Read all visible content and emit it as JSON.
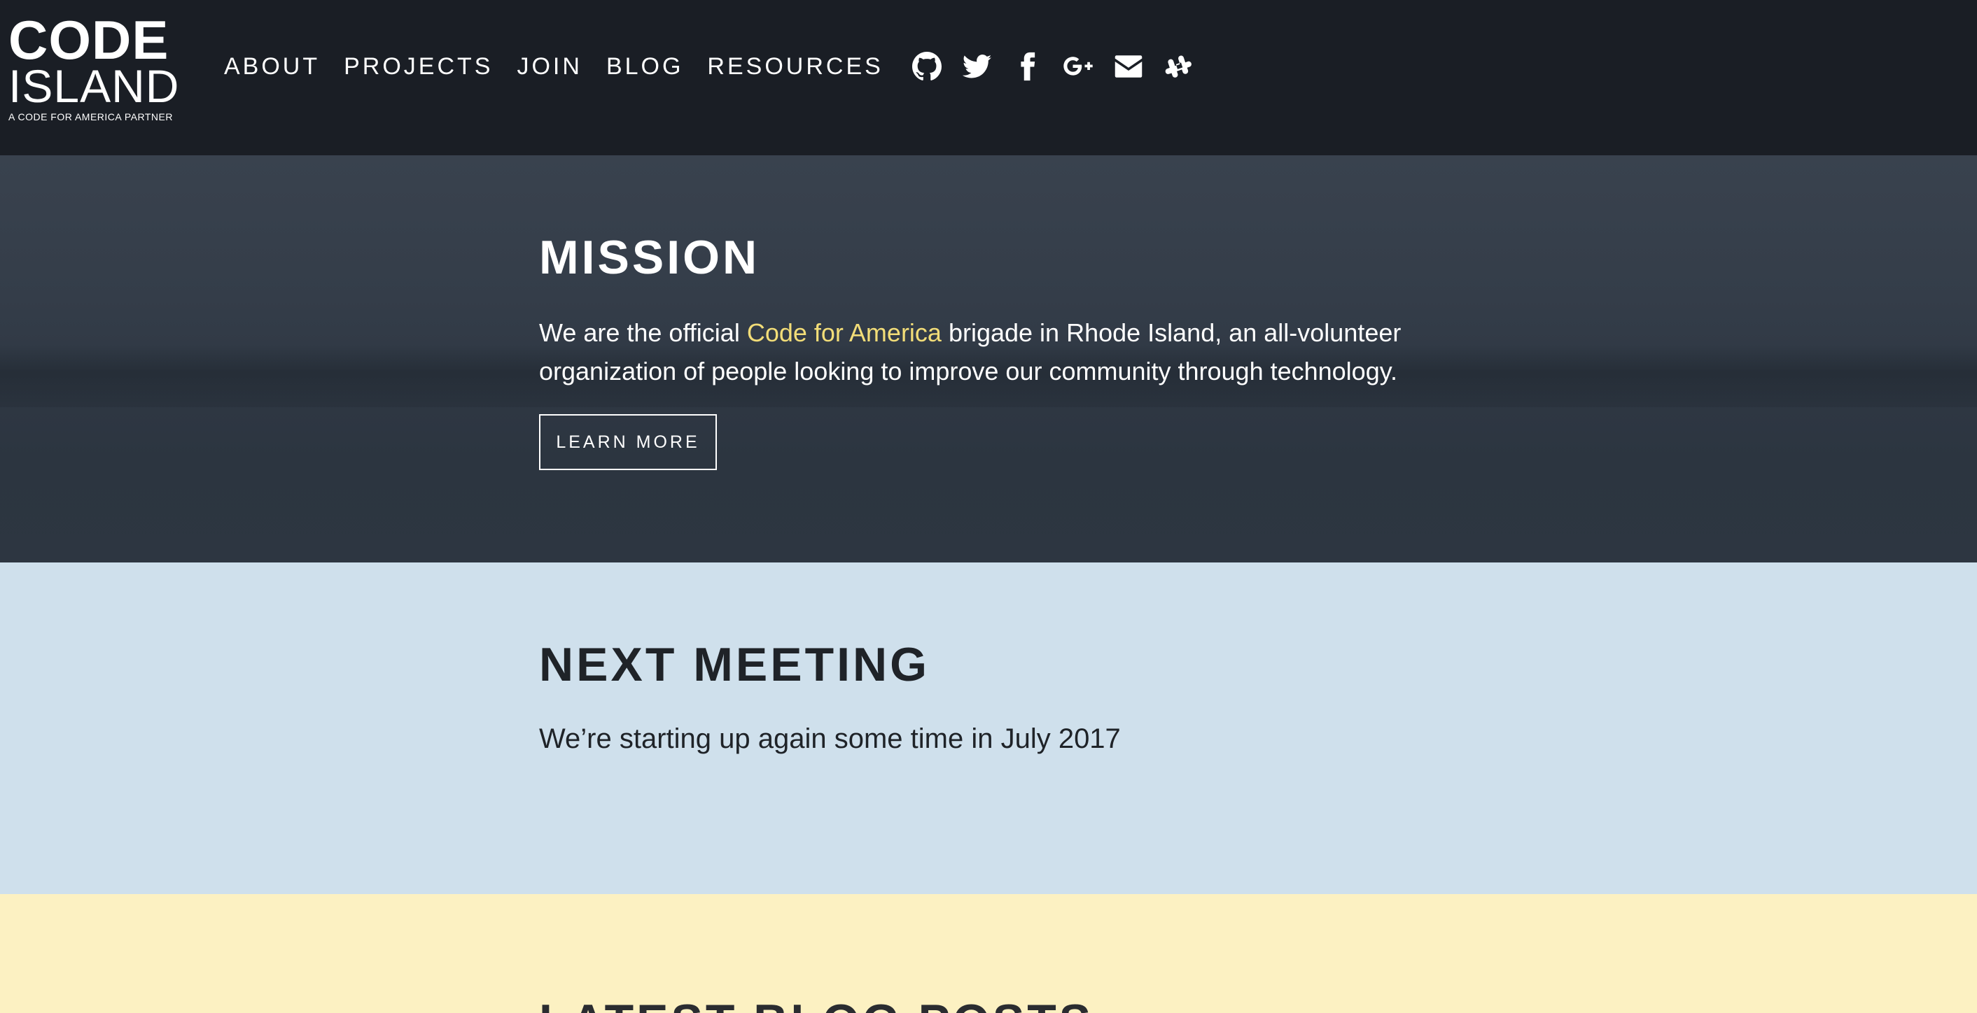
{
  "header": {
    "logo": {
      "line1": "CODE",
      "line2": "ISLAND",
      "tagline": "A CODE FOR AMERICA PARTNER"
    },
    "nav": [
      {
        "label": "ABOUT"
      },
      {
        "label": "PROJECTS"
      },
      {
        "label": "JOIN"
      },
      {
        "label": "BLOG"
      },
      {
        "label": "RESOURCES"
      }
    ],
    "social_icons": [
      "github-icon",
      "twitter-icon",
      "facebook-icon",
      "google-plus-icon",
      "email-icon",
      "slack-icon"
    ]
  },
  "mission": {
    "title": "MISSION",
    "text_before": "We are the official ",
    "link_text": "Code for America",
    "text_after": " brigade in Rhode Island, an all-volunteer organization of people looking to improve our community through technology.",
    "button_label": "LEARN MORE"
  },
  "meeting": {
    "title": "NEXT MEETING",
    "text": "We’re starting up again some time in July 2017"
  },
  "blog": {
    "title": "LATEST BLOG POSTS"
  },
  "colors": {
    "header_bg": "#1a1e25",
    "mission_bg": "#343d49",
    "accent_link": "#f2dd78",
    "meeting_bg": "#cfe0ec",
    "blog_bg": "#fcf1c2"
  }
}
